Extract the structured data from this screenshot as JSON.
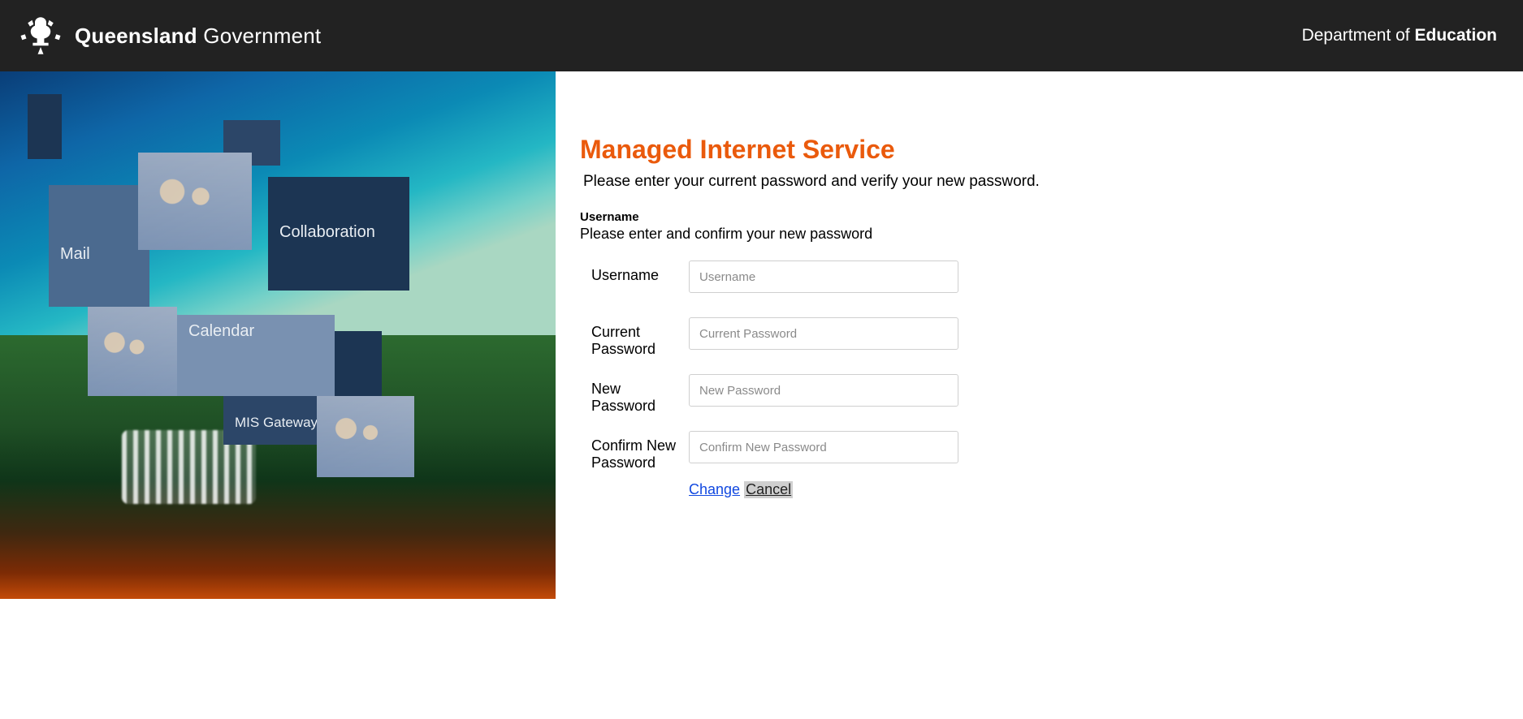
{
  "header": {
    "brand_bold": "Queensland",
    "brand_light": "Government",
    "dept_pre": "Department of",
    "dept_post": "Education"
  },
  "hero_tiles": {
    "mail": "Mail",
    "collaboration": "Collaboration",
    "calendar": "Calendar",
    "mis_gateway": "MIS Gateway"
  },
  "page": {
    "title": "Managed Internet Service",
    "subtitle": " Please enter your current password and verify your new password.",
    "username_heading": "Username",
    "instruction": "Please enter and confirm your new password"
  },
  "form": {
    "username": {
      "label": "Username",
      "placeholder": "Username",
      "value": ""
    },
    "current_password": {
      "label": "Current Password",
      "placeholder": "Current Password",
      "value": ""
    },
    "new_password": {
      "label": "New Password",
      "placeholder": "New Password",
      "value": ""
    },
    "confirm_new_password": {
      "label": "Confirm New Password",
      "placeholder": "Confirm New Password",
      "value": ""
    },
    "change_label": "Change",
    "cancel_label": "Cancel"
  }
}
